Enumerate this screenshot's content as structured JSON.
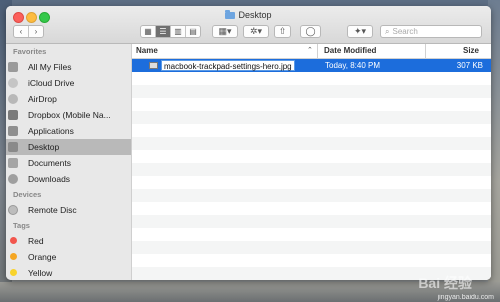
{
  "window": {
    "title": "Desktop"
  },
  "toolbar": {
    "back": "‹",
    "forward": "›",
    "view_icons": [
      "▦",
      "☰",
      "▥",
      "▤"
    ],
    "arrange": "▦▾",
    "action": "✲▾",
    "share": "⇧",
    "tags": "◯",
    "dropbox": "✦▾",
    "search_placeholder": "Search"
  },
  "sidebar": {
    "sections": [
      {
        "header": "Favorites",
        "items": [
          {
            "label": "All My Files",
            "icon": "all-files-icon"
          },
          {
            "label": "iCloud Drive",
            "icon": "icloud-icon"
          },
          {
            "label": "AirDrop",
            "icon": "airdrop-icon"
          },
          {
            "label": "Dropbox (Mobile Na...",
            "icon": "dropbox-icon"
          },
          {
            "label": "Applications",
            "icon": "applications-icon"
          },
          {
            "label": "Desktop",
            "icon": "desktop-icon",
            "selected": true
          },
          {
            "label": "Documents",
            "icon": "documents-icon"
          },
          {
            "label": "Downloads",
            "icon": "downloads-icon"
          }
        ]
      },
      {
        "header": "Devices",
        "items": [
          {
            "label": "Remote Disc",
            "icon": "remote-disc-icon"
          }
        ]
      },
      {
        "header": "Tags",
        "items": [
          {
            "label": "Red",
            "color": "#f2564d"
          },
          {
            "label": "Orange",
            "color": "#f5a623"
          },
          {
            "label": "Yellow",
            "color": "#f8d32b"
          }
        ]
      }
    ]
  },
  "columns": {
    "name": "Name",
    "sort_indicator": "⌃",
    "date": "Date Modified",
    "size": "Size"
  },
  "files": [
    {
      "name": "macbook-trackpad-settings-hero.jpg",
      "date": "Today, 8:40 PM",
      "size": "307 KB"
    }
  ],
  "watermark": {
    "logo": "Bai 经验",
    "url": "jingyan.baidu.com"
  }
}
